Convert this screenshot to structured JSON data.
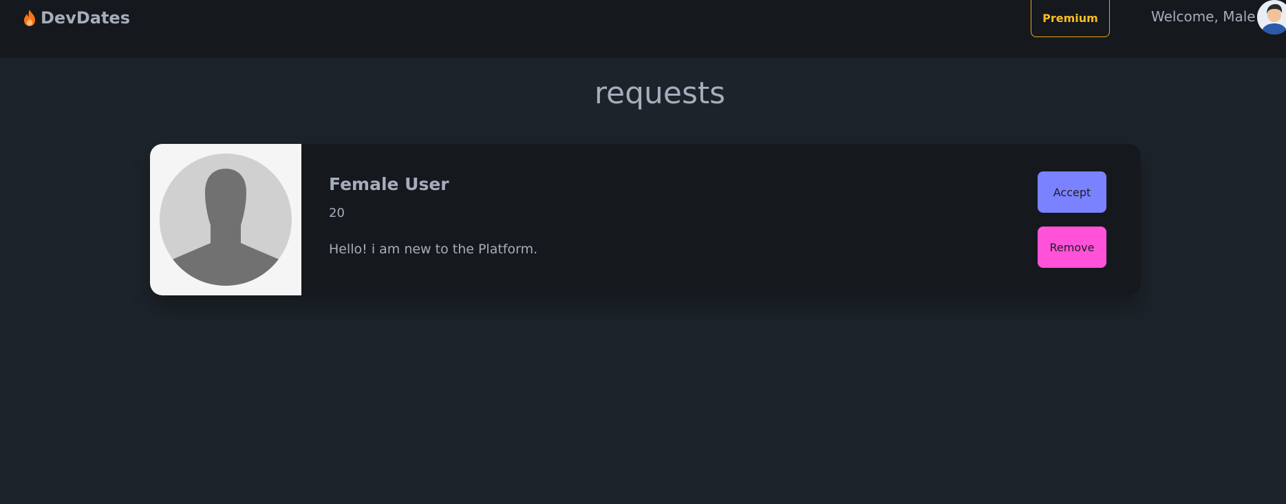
{
  "navbar": {
    "brand": "DevDates",
    "premium_label": "Premium",
    "welcome_text": "Welcome, Male"
  },
  "page": {
    "title": "requests"
  },
  "requests": [
    {
      "name": "Female User",
      "age": "20",
      "about": "Hello! i am new to the Platform.",
      "accept_label": "Accept",
      "remove_label": "Remove"
    }
  ],
  "colors": {
    "background": "#1d232a",
    "navbar": "#15191e",
    "card": "#15191e",
    "accept": "#7b82ff",
    "remove": "#ff52d9",
    "premium": "#fbbd23",
    "flame": "#f97316"
  },
  "icons": {
    "brand": "flame-icon",
    "profile_placeholder": "user-silhouette-icon",
    "nav_avatar": "user-avatar"
  }
}
